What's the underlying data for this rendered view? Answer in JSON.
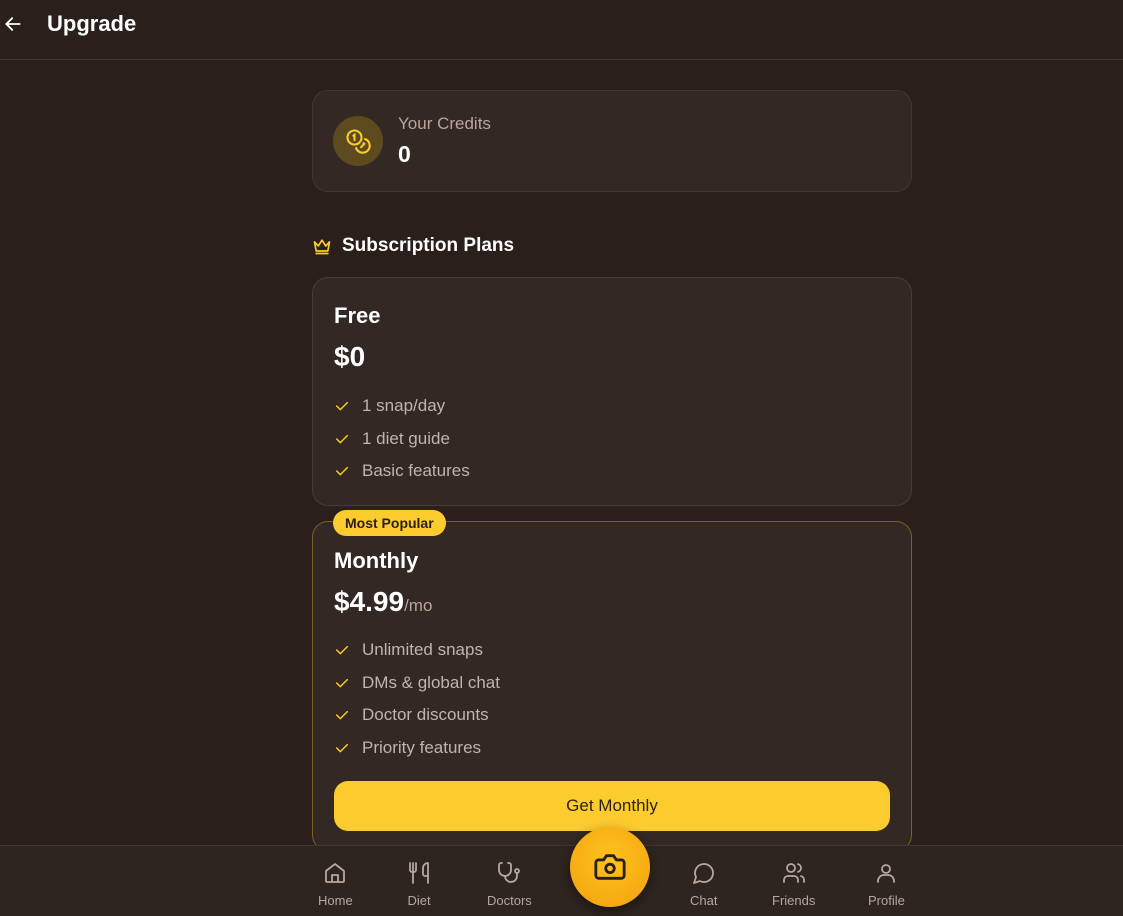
{
  "header": {
    "title": "Upgrade"
  },
  "credits": {
    "label": "Your Credits",
    "value": "0"
  },
  "plans_section": {
    "title": "Subscription Plans"
  },
  "plans": [
    {
      "name": "Free",
      "price": "$0",
      "period": "",
      "features": [
        "1 snap/day",
        "1 diet guide",
        "Basic features"
      ]
    },
    {
      "name": "Monthly",
      "badge": "Most Popular",
      "price": "$4.99",
      "period": "/mo",
      "features": [
        "Unlimited snaps",
        "DMs & global chat",
        "Doctor discounts",
        "Priority features"
      ],
      "cta": "Get Monthly"
    }
  ],
  "nav": {
    "items": [
      {
        "label": "Home",
        "icon": "home-icon"
      },
      {
        "label": "Diet",
        "icon": "utensils-icon"
      },
      {
        "label": "Doctors",
        "icon": "stethoscope-icon"
      },
      {
        "label": "Chat",
        "icon": "chat-bubble-icon"
      },
      {
        "label": "Friends",
        "icon": "users-icon"
      },
      {
        "label": "Profile",
        "icon": "user-icon"
      }
    ],
    "camera_icon": "camera-icon"
  },
  "colors": {
    "background": "#2a1f1b",
    "card": "#332823",
    "accent": "#fccb2e",
    "muted_text": "#b7a79c"
  }
}
